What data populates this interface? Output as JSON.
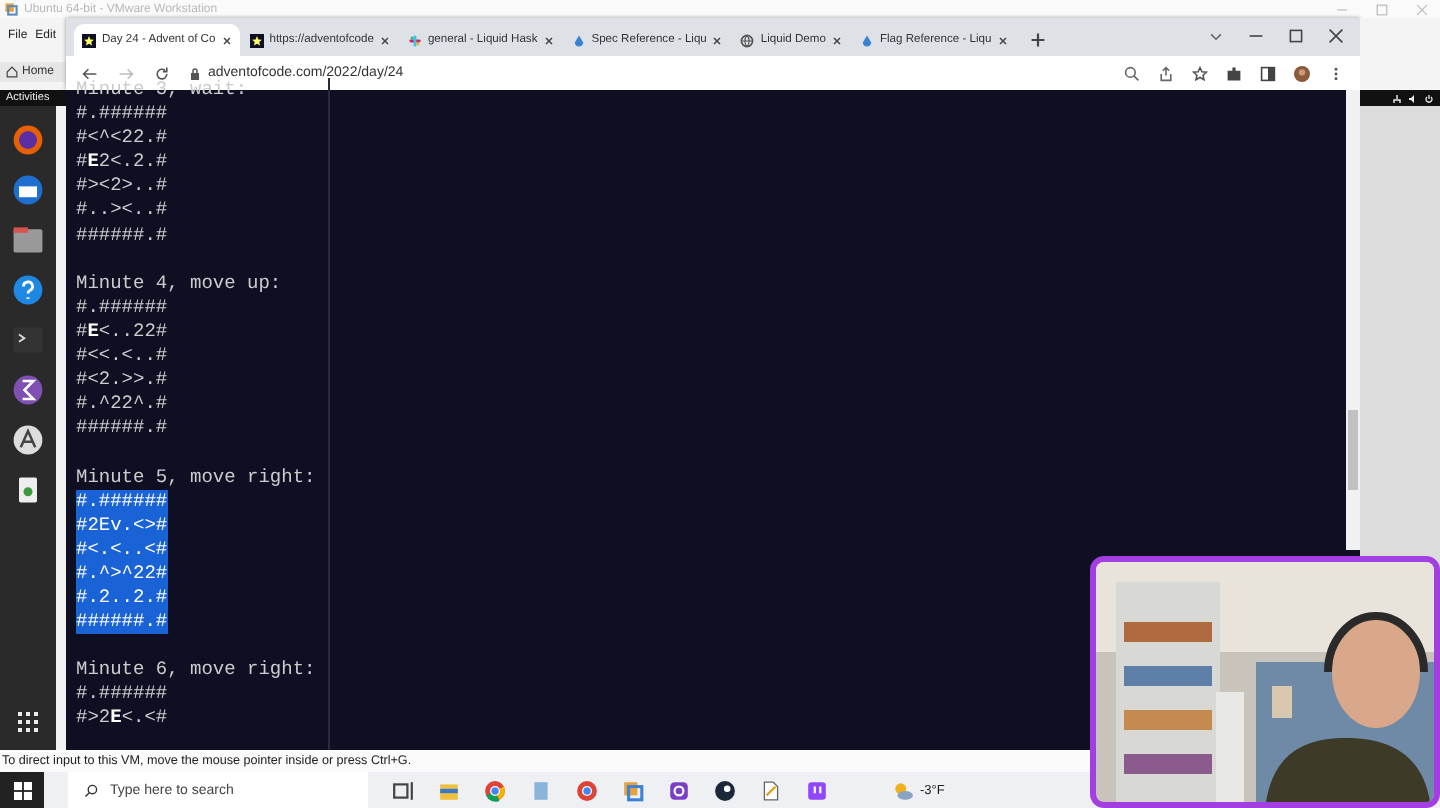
{
  "vm_window": {
    "title": "Ubuntu 64-bit - VMware Workstation",
    "menu": [
      "File",
      "Edit"
    ],
    "home_tab": "Home",
    "status_bar": "To direct input to this VM, move the mouse pointer inside or press Ctrl+G."
  },
  "ubuntu": {
    "activities": "Activities"
  },
  "browser": {
    "tabs": [
      {
        "title": "Day 24 - Advent of Co",
        "selected": true
      },
      {
        "title": "https://adventofcode",
        "selected": false
      },
      {
        "title": "general - Liquid Hask",
        "selected": false
      },
      {
        "title": "Spec Reference - Liqu",
        "selected": false
      },
      {
        "title": "Liquid Demo",
        "selected": false
      },
      {
        "title": "Flag Reference - Liqu",
        "selected": false
      }
    ],
    "address": "adventofcode.com/2022/day/24"
  },
  "page": {
    "blocks": [
      {
        "heading": "Minute 3, wait:",
        "selected": false,
        "rows": [
          "#.######",
          "#<^<22.#",
          "#**E**2<.2.#",
          "#><2>..#",
          "#..><..#",
          "######.#"
        ]
      },
      {
        "heading": "Minute 4, move up:",
        "selected": false,
        "rows": [
          "#.######",
          "#**E**<..22#",
          "#<<.<..#",
          "#<2.>>.#",
          "#.^22^.#",
          "######.#"
        ]
      },
      {
        "heading": "Minute 5, move right:",
        "selected": true,
        "rows": [
          "#.######",
          "#2Ev.<>#",
          "#<.<..<#",
          "#.^>^22#",
          "#.2..2.#",
          "######.#"
        ]
      },
      {
        "heading": "Minute 6, move right:",
        "selected": false,
        "rows": [
          "#.######",
          "#>2**E**<.<#"
        ]
      }
    ]
  },
  "taskbar": {
    "search_placeholder": "Type here to search",
    "weather": "-3°F"
  }
}
